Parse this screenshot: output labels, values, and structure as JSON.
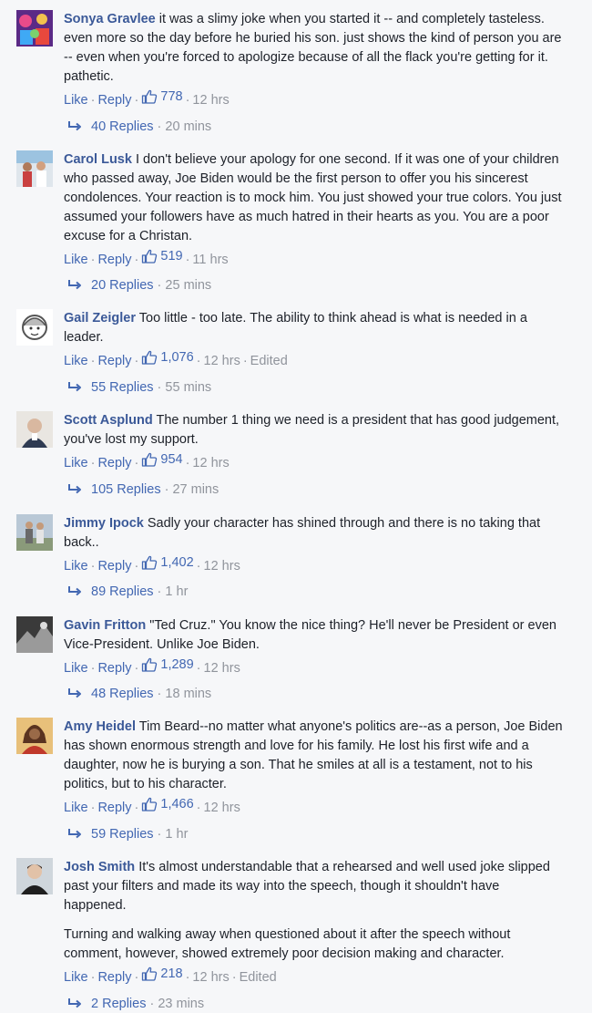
{
  "actions": {
    "like": "Like",
    "reply": "Reply"
  },
  "comments": [
    {
      "author": "Sonya Gravlee",
      "text": "it was a slimy joke when you started it -- and completely tasteless. even more so the day before he buried his son. just shows the kind of person you are -- even when you're forced to apologize because of all the flack you're getting for it. pathetic.",
      "likes": "778",
      "time": "12 hrs",
      "edited": "",
      "replies": "40 Replies",
      "reply_time": "20 mins"
    },
    {
      "author": "Carol Lusk",
      "text": "I don't believe your apology for one second. If it was one of your children who passed away, Joe Biden would be the first person to offer you his sincerest condolences. Your reaction is to mock him. You just showed your true colors. You just assumed your followers have as much hatred in their hearts as you. You are a poor excuse for a Christan.",
      "likes": "519",
      "time": "11 hrs",
      "edited": "",
      "replies": "20 Replies",
      "reply_time": "25 mins"
    },
    {
      "author": "Gail Zeigler",
      "text": "Too little - too late. The ability to think ahead is what is needed in a leader.",
      "likes": "1,076",
      "time": "12 hrs",
      "edited": "Edited",
      "replies": "55 Replies",
      "reply_time": "55 mins"
    },
    {
      "author": "Scott Asplund",
      "text": "The number 1 thing we need is a president that has good judgement, you've lost my support.",
      "likes": "954",
      "time": "12 hrs",
      "edited": "",
      "replies": "105 Replies",
      "reply_time": "27 mins"
    },
    {
      "author": "Jimmy Ipock",
      "text": "Sadly your character has shined through and there is no taking that back..",
      "likes": "1,402",
      "time": "12 hrs",
      "edited": "",
      "replies": "89 Replies",
      "reply_time": "1 hr"
    },
    {
      "author": "Gavin Fritton",
      "text": "\"Ted Cruz.\" You know the nice thing? He'll never be President or even Vice-President. Unlike Joe Biden.",
      "likes": "1,289",
      "time": "12 hrs",
      "edited": "",
      "replies": "48 Replies",
      "reply_time": "18 mins"
    },
    {
      "author": "Amy Heidel",
      "text": "Tim Beard--no matter what anyone's politics are--as a person, Joe Biden has shown enormous strength and love for his family. He lost his first wife and a daughter, now he is burying a son. That he smiles at all is a testament, not to his politics, but to his character.",
      "likes": "1,466",
      "time": "12 hrs",
      "edited": "",
      "replies": "59 Replies",
      "reply_time": "1 hr"
    },
    {
      "author": "Josh Smith",
      "text": "It's almost understandable that a rehearsed and well used joke slipped past your filters and made its way into the speech, though it shouldn't have happened.",
      "text2": "Turning and walking away when questioned about it after the speech without comment, however, showed extremely poor decision making and character.",
      "likes": "218",
      "time": "12 hrs",
      "edited": "Edited",
      "replies": "2 Replies",
      "reply_time": "23 mins"
    }
  ]
}
